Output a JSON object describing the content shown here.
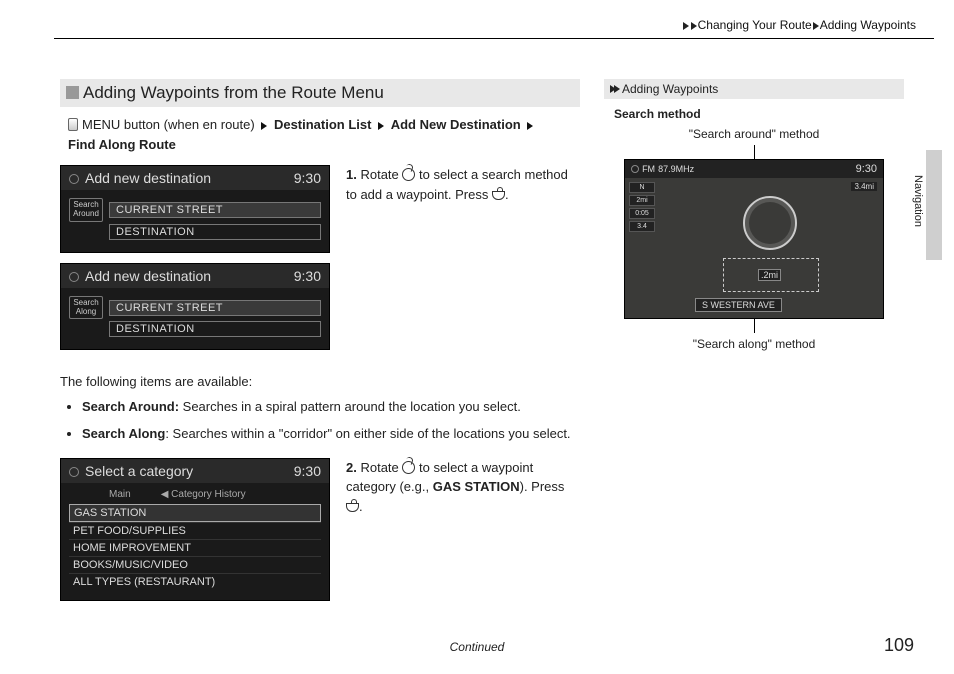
{
  "breadcrumb": {
    "a": "Changing Your Route",
    "b": "Adding Waypoints"
  },
  "section_title": "Adding Waypoints from the Route Menu",
  "navpath": {
    "pre": "MENU button (when en route)",
    "p1": "Destination List",
    "p2": "Add New Destination",
    "p3": "Find Along Route"
  },
  "shot1": {
    "title": "Add new destination",
    "time": "9:30",
    "btn": "Search Around",
    "r1": "CURRENT STREET",
    "r2": "DESTINATION"
  },
  "shot2": {
    "title": "Add new destination",
    "time": "9:30",
    "btn": "Search Along",
    "r1": "CURRENT STREET",
    "r2": "DESTINATION"
  },
  "step1": {
    "num": "1.",
    "a": "Rotate ",
    "b": " to select a search method to add a waypoint. Press ",
    "c": "."
  },
  "avail": "The following items are available:",
  "bul1": {
    "t": "Search Around:",
    "d": " Searches in a spiral pattern around the location you select."
  },
  "bul2": {
    "t": "Search Along",
    "d": ": Searches within a \"corridor\" on either side of the locations you select."
  },
  "shot3": {
    "title": "Select a category",
    "time": "9:30",
    "tab1": "Main",
    "tab2": "Category History",
    "i1": "GAS STATION",
    "i2": "PET FOOD/SUPPLIES",
    "i3": "HOME IMPROVEMENT",
    "i4": "BOOKS/MUSIC/VIDEO",
    "i5": "ALL TYPES (RESTAURANT)"
  },
  "step2": {
    "num": "2.",
    "a": "Rotate ",
    "b": " to select a waypoint category (e.g., ",
    "eg": "GAS STATION",
    "c": "). Press ",
    "d": "."
  },
  "note_hd": "Adding Waypoints",
  "sm_title": "Search method",
  "cap_top": "\"Search around\" method",
  "cap_bot": "\"Search along\" method",
  "map": {
    "fm": "FM",
    "freq": "87.9MHz",
    "time": "9:30",
    "scale": "3.4mi",
    "s1": "N",
    "s2": "2mi",
    "s3": "0:05",
    "s4": "3.4",
    "box": ".2mi",
    "street": "S WESTERN AVE"
  },
  "vtab": "Navigation",
  "continued": "Continued",
  "pagenum": "109"
}
